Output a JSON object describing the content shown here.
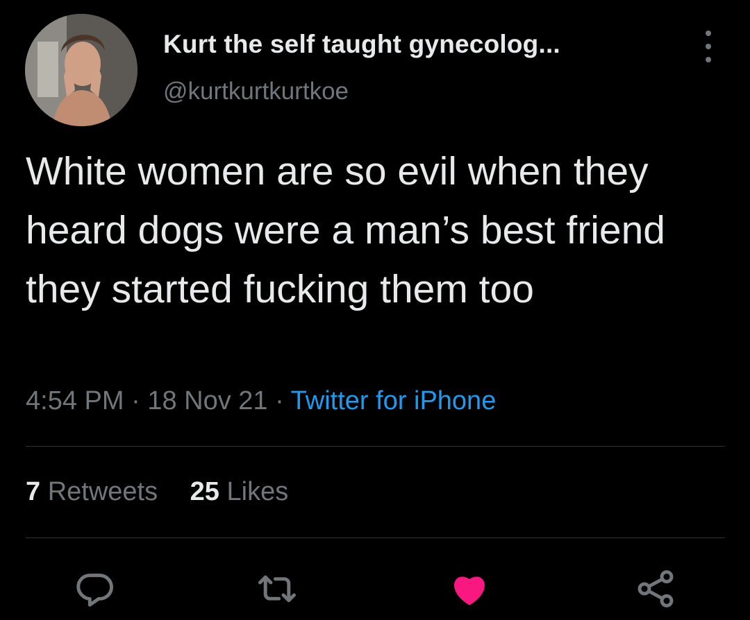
{
  "author": {
    "display_name": "Kurt the self taught gynecolog...",
    "handle": "@kurtkurtkurtkoe"
  },
  "tweet": {
    "text": "White women are so evil when they heard dogs were a man’s best friend they started fucking them too",
    "time": "4:54 PM",
    "date": "18 Nov 21",
    "separator": "·",
    "source": "Twitter for iPhone"
  },
  "stats": {
    "retweets_count": "7",
    "retweets_label": "Retweets",
    "likes_count": "25",
    "likes_label": "Likes"
  },
  "actions": [
    {
      "name": "reply-icon"
    },
    {
      "name": "retweet-icon"
    },
    {
      "name": "like-icon",
      "active": true
    },
    {
      "name": "share-icon"
    }
  ],
  "colors": {
    "background": "#000000",
    "text_primary": "#e7e9ea",
    "text_secondary": "#71767b",
    "link": "#1d9bf0",
    "like_active": "#f91880",
    "divider": "#2f3336"
  }
}
